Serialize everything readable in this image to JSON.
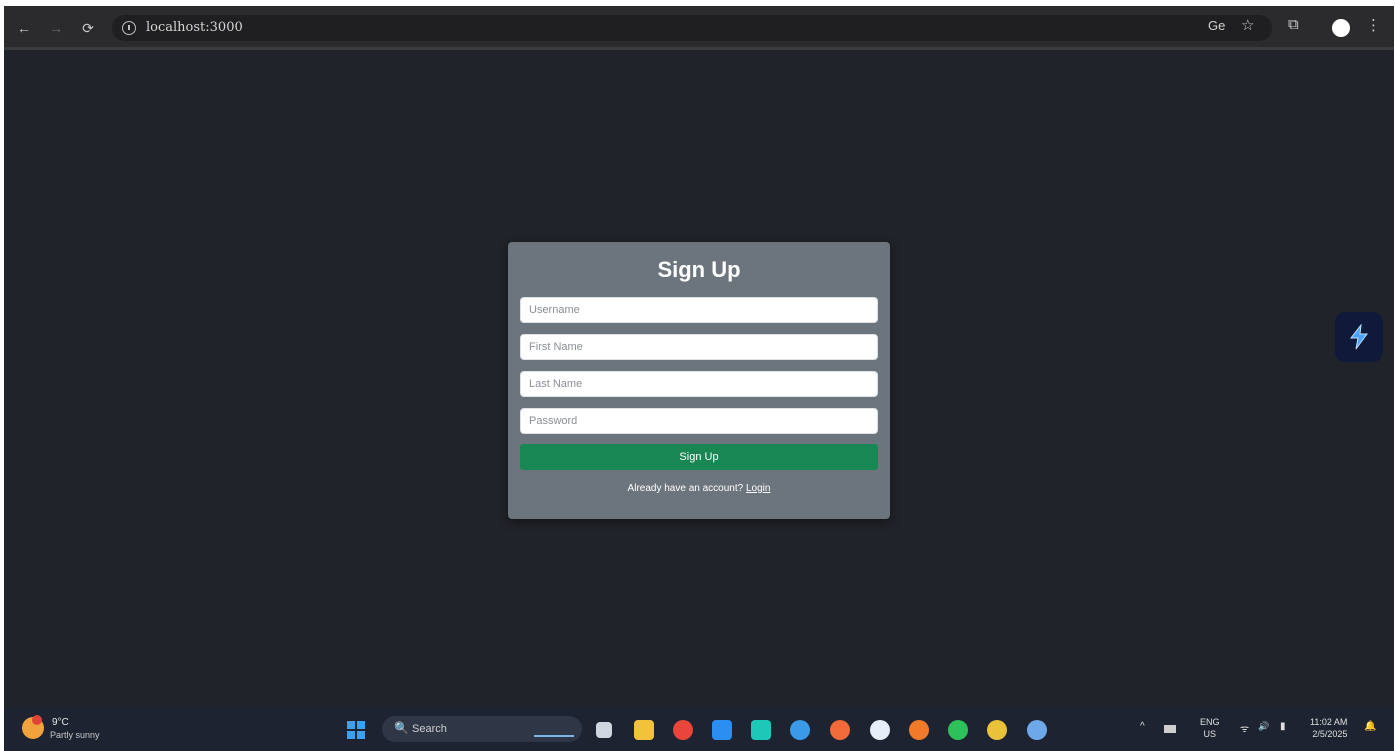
{
  "browser": {
    "url": "localhost:3000",
    "back": "←",
    "forward": "→",
    "reload": "⟳",
    "star": "☆",
    "extensions": "⧉",
    "menu": "⋮",
    "translate": "Gе"
  },
  "signup": {
    "title": "Sign Up",
    "username_placeholder": "Username",
    "firstname_placeholder": "First Name",
    "lastname_placeholder": "Last Name",
    "password_placeholder": "Password",
    "submit_label": "Sign Up",
    "footer_text": "Already have an account?",
    "login_link": "Login",
    "colors": {
      "card": "#6c757d",
      "button": "#198754",
      "background": "#202329"
    }
  },
  "taskbar": {
    "weather_temp": "9°C",
    "weather_condition": "Partly sunny",
    "search_label": "Search",
    "search_glyph": "🔍",
    "lang_top": "ENG",
    "lang_bottom": "US",
    "time": "11:02 AM",
    "date": "2/5/2025",
    "tray_chevron": "^",
    "tray_net": "ᯤ",
    "tray_vol": "🔊",
    "tray_bat": "▮",
    "bell": "🔔"
  }
}
